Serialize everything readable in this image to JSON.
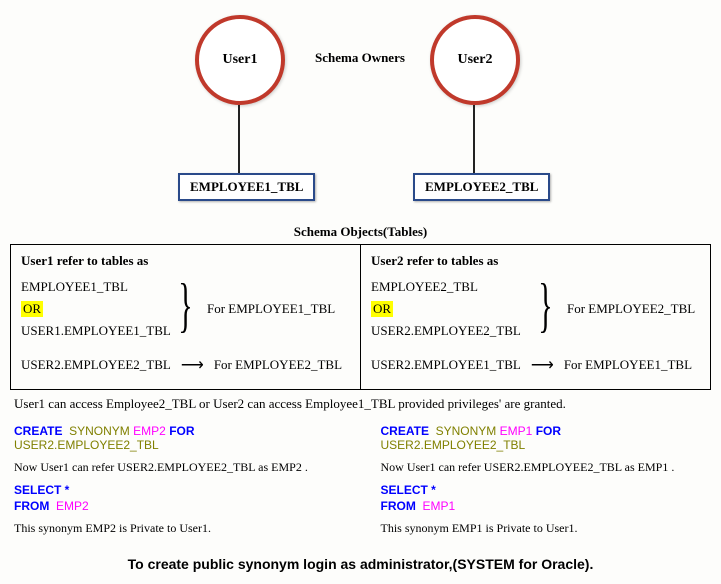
{
  "top": {
    "user1": "User1",
    "user2": "User2",
    "schema_owners": "Schema Owners",
    "tbl1": "EMPLOYEE1_TBL",
    "tbl2": "EMPLOYEE2_TBL",
    "schema_objects": "Schema Objects(Tables)"
  },
  "left": {
    "title": "User1 refer to tables as",
    "row1": "EMPLOYEE1_TBL",
    "or": "OR",
    "row2": "USER1.EMPLOYEE1_TBL",
    "for1": "For EMPLOYEE1_TBL",
    "row3a": "USER2.EMPLOYEE2_TBL",
    "row3b": "For EMPLOYEE2_TBL"
  },
  "right": {
    "title": "User2 refer to tables as",
    "row1": "EMPLOYEE2_TBL",
    "or": "OR",
    "row2": "USER2.EMPLOYEE2_TBL",
    "for1": "For  EMPLOYEE2_TBL",
    "row3a": "USER2.EMPLOYEE1_TBL",
    "row3b": "For EMPLOYEE1_TBL"
  },
  "privilege_note": "User1 can access Employee2_TBL or User2 can access Employee1_TBL provided privileges' are granted.",
  "code_left": {
    "create": "CREATE",
    "synonym": "SYNONYM",
    "emp": "EMP2",
    "for": "FOR",
    "target": "USER2.EMPLOYEE2_TBL",
    "now": "Now User1 can refer USER2.EMPLOYEE2_TBL as  EMP2 .",
    "select": "SELECT  *",
    "from": "FROM",
    "from_emp": "EMP2",
    "private": "This synonym EMP2 is Private to User1."
  },
  "code_right": {
    "create": "CREATE",
    "synonym": "SYNONYM",
    "emp": "EMP1",
    "for": "FOR",
    "target": "USER2.EMPLOYEE2_TBL",
    "now": "Now User1 can refer USER2.EMPLOYEE2_TBL as  EMP1 .",
    "select": "SELECT  *",
    "from": "FROM",
    "from_emp": "EMP1",
    "private": "This synonym EMP1 is Private to User1."
  },
  "footer": "To create public synonym login as administrator,(SYSTEM for Oracle)."
}
